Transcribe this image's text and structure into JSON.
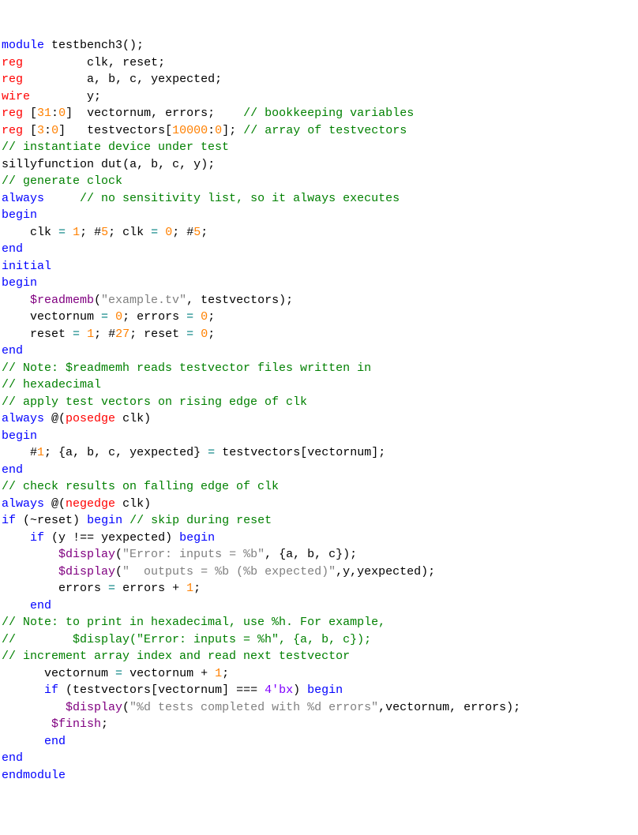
{
  "t": {
    "module": "module",
    "reg": "reg",
    "wire": "wire",
    "always": "always",
    "begin": "begin",
    "end": "end",
    "initial": "initial",
    "if": "if",
    "posedge": "posedge",
    "negedge": "negedge",
    "endmodule": "endmodule",
    "testbench3": "testbench3",
    "clk": "clk",
    "reset": "reset",
    "a": "a",
    "b": "b",
    "c": "c",
    "yexpected": "yexpected",
    "y": "y",
    "vectornum": "vectornum",
    "errors": "errors",
    "testvectors": "testvectors",
    "sillyfunction": "sillyfunction",
    "dut": "dut",
    "readmemb": "$readmemb",
    "display": "$display",
    "finish": "$finish",
    "eq": "=",
    "n31": "31",
    "n0": "0",
    "n3": "3",
    "n10000": "10000",
    "n1": "1",
    "n5": "5",
    "n27": "27",
    "lit4bx": "4'bx",
    "str_example": "\"example.tv\"",
    "str_err1": "\"Error: inputs = %b\"",
    "str_out": "\"  outputs = %b (%b expected)\"",
    "str_done": "\"%d tests completed with %d errors\"",
    "c_bookkeeping": "// bookkeeping variables",
    "c_arraytv": "// array of testvectors",
    "c_inst": "// instantiate device under test",
    "c_genclk": "// generate clock",
    "c_nosens": "// no sensitivity list, so it always executes",
    "c_note1a": "// Note: $readmemh reads testvector files written in",
    "c_note1b": "// hexadecimal",
    "c_apply": "// apply test vectors on rising edge of clk",
    "c_check": "// check results on falling edge of clk",
    "c_skip": "// skip during reset",
    "c_note2a": "// Note: to print in hexadecimal, use %h. For example,",
    "c_note2b": "//        $display(\"Error: inputs = %h\", {a, b, c});",
    "c_incr": "// increment array index and read next testvector"
  }
}
